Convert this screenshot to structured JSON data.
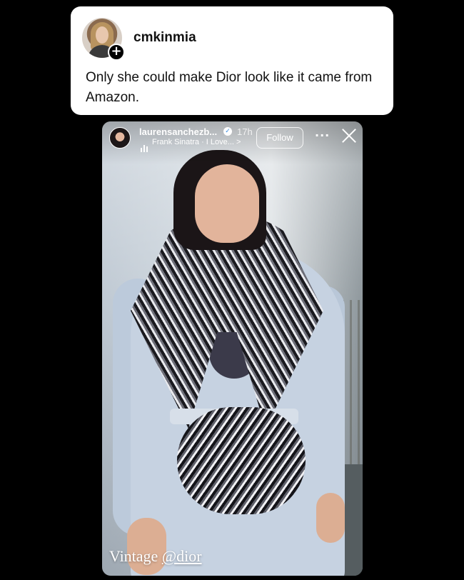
{
  "post": {
    "username": "cmkinmia",
    "plus_icon": "plus-icon",
    "text": "Only she could make Dior look like it came from Amazon."
  },
  "story": {
    "username": "laurensanchezb...",
    "verified_icon": "verified-badge-icon",
    "verified_glyph": "✓",
    "time": "17h",
    "music": "Frank Sinatra · I Love... >",
    "follow_label": "Follow",
    "more_icon": "more-horizontal-icon",
    "more_glyph": "···",
    "close_icon": "close-icon",
    "caption_text": "Vintage ",
    "caption_mention": "@dior"
  },
  "colors": {
    "background": "#000000",
    "card": "#ffffff",
    "text": "#111111"
  }
}
